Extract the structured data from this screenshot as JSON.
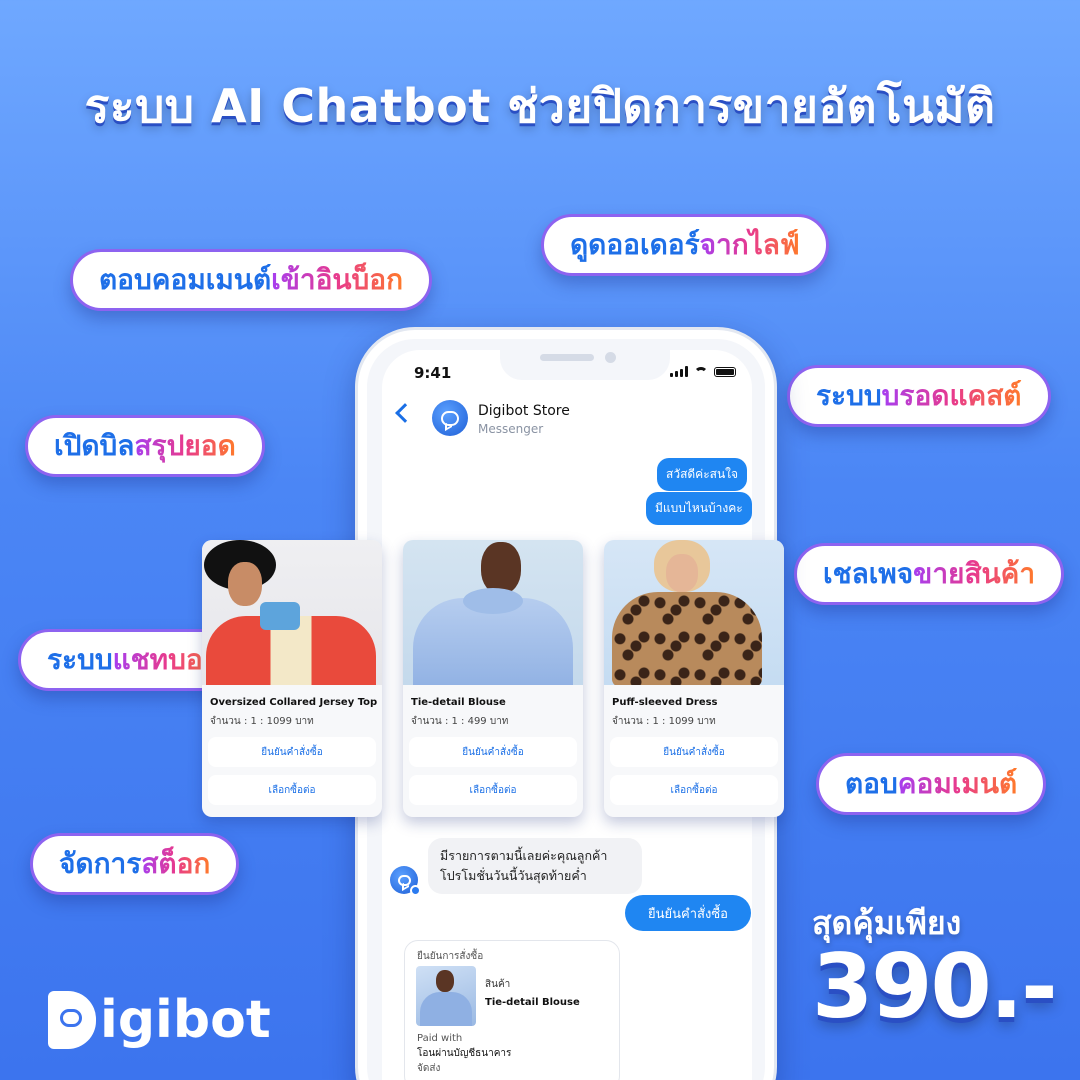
{
  "headline": "ระบบ AI Chatbot ช่วยปิดการขายอัตโนมัติ",
  "features": {
    "live_orders": {
      "a": "ดูดออเดอร์",
      "b": "จากไลฟ์"
    },
    "comment_inbox": {
      "a": "ตอบคอมเมนต์",
      "b": "เข้าอินบ็อก"
    },
    "broadcast": {
      "a": "ระบบ",
      "b": "บรอดแคสต์"
    },
    "bill": {
      "a": "เปิดบิล",
      "b": "สรุปยอด"
    },
    "sales_page": {
      "a": "เชลเพจ",
      "b": "ขายสินค้า"
    },
    "chatbot": {
      "a": "ระบบ",
      "b": "แชทบอท"
    },
    "reply_comment": {
      "a": "ตอบ",
      "b": "คอมเมนต์"
    },
    "stock": {
      "a": "จัดการ",
      "b": "สต็อก"
    }
  },
  "phone": {
    "time": "9:41",
    "store_name": "Digibot Store",
    "store_sub": "Messenger",
    "messages_out": [
      "สวัสดีค่ะสนใจ",
      "มีแบบไหนบ้างคะ"
    ],
    "products": [
      {
        "name": "Oversized Collared Jersey Top",
        "qty": "จำนวน : 1 : 1099 บาท",
        "confirm": "ยืนยันคำสั่งซื้อ",
        "more": "เลือกซื้อต่อ"
      },
      {
        "name": "Tie-detail Blouse",
        "qty": "จำนวน : 1 : 499 บาท",
        "confirm": "ยืนยันคำสั่งซื้อ",
        "more": "เลือกซื้อต่อ"
      },
      {
        "name": "Puff-sleeved Dress",
        "qty": "จำนวน : 1 : 1099 บาท",
        "confirm": "ยืนยันคำสั่งซื้อ",
        "more": "เลือกซื้อต่อ"
      }
    ],
    "bot_message_line1": "มีรายการตามนี้เลยค่ะคุณลูกค้า",
    "bot_message_line2": "โปรโมชั่นวันนี้วันสุดท้ายค่ำ",
    "confirm_button": "ยืนยันคำสั่งซื้อ",
    "receipt": {
      "header": "ยืนยันการสั่งซื้อ",
      "item_label": "สินค้า",
      "item_name": "Tie-detail Blouse",
      "paid_with": "Paid with",
      "payment": "โอนผ่านบัญชีธนาคาร",
      "shipping": "จัดส่ง"
    }
  },
  "price_label": "สุดคุ้มเพียง",
  "price": "390.-",
  "logo": "igibot",
  "colors": {
    "accent": "#1f86f2",
    "background": "#4b86f5",
    "pill_border": "#8d63f0"
  },
  "icons": [
    "back-chevron-icon",
    "chat-bubble-icon",
    "signal-icon",
    "wifi-icon",
    "battery-icon"
  ]
}
